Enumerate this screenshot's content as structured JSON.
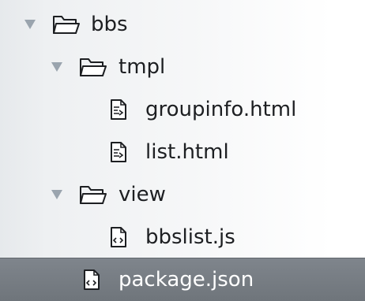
{
  "file_tree": {
    "items": [
      {
        "label": "bbs",
        "kind": "folder",
        "expanded": true,
        "depth": 0,
        "icon": "folder-open-icon",
        "disclosure_icon": "triangle-down-icon"
      },
      {
        "label": "tmpl",
        "kind": "folder",
        "expanded": true,
        "depth": 1,
        "icon": "folder-open-icon",
        "disclosure_icon": "triangle-down-icon"
      },
      {
        "label": "groupinfo.html",
        "kind": "file",
        "depth": 2,
        "icon": "html-file-icon"
      },
      {
        "label": "list.html",
        "kind": "file",
        "depth": 2,
        "icon": "html-file-icon"
      },
      {
        "label": "view",
        "kind": "folder",
        "expanded": true,
        "depth": 1,
        "icon": "folder-open-icon",
        "disclosure_icon": "triangle-down-icon"
      },
      {
        "label": "bbslist.js",
        "kind": "file",
        "depth": 2,
        "icon": "code-file-icon"
      },
      {
        "label": "package.json",
        "kind": "file",
        "depth": 1,
        "icon": "code-file-icon",
        "selected": true
      }
    ]
  },
  "colors": {
    "selection": "#737980",
    "text": "#1d1f22",
    "selected_text": "#ffffff",
    "disclosure": "#9aa4ae"
  }
}
